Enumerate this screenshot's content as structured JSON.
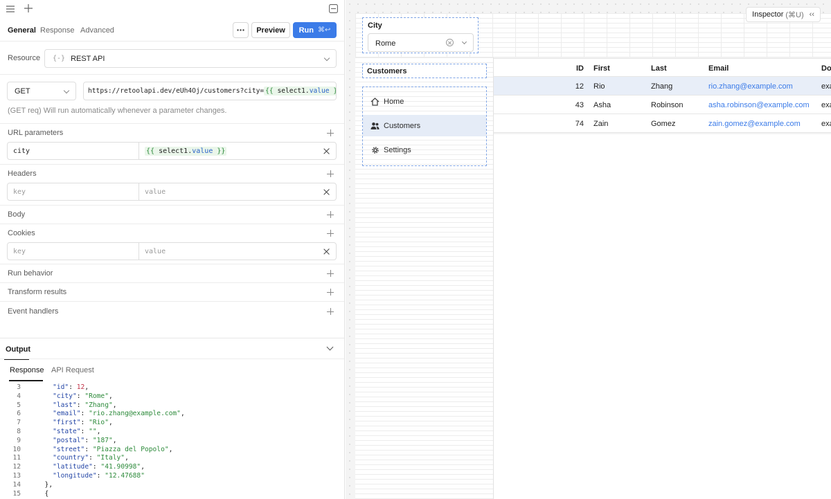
{
  "left": {
    "tabs": [
      "General",
      "Response",
      "Advanced"
    ],
    "buttons": {
      "preview": "Preview",
      "run": "Run",
      "run_shortcut": "⌘↩"
    },
    "resource_label": "Resource",
    "resource_value": "REST API",
    "method": "GET",
    "url_prefix": "https://retoolapi.dev/eUh4Oj/customers?city=",
    "url_template_open": "{{ ",
    "url_template_id": "select1",
    "url_template_dot": ".",
    "url_template_prop": "value",
    "url_template_close": " }}",
    "hint": "(GET req) Will run automatically whenever a parameter changes.",
    "sections": {
      "url_params": "URL parameters",
      "headers": "Headers",
      "body": "Body",
      "cookies": "Cookies",
      "run_behavior": "Run behavior",
      "transform": "Transform results",
      "event_handlers": "Event handlers"
    },
    "url_param": {
      "key": "city",
      "t_open": "{{ ",
      "t_id": "select1",
      "t_dot": ".",
      "t_prop": "value",
      "t_close": " }}"
    },
    "kv_placeholder": {
      "key": "key",
      "value": "value"
    }
  },
  "output": {
    "title": "Output",
    "tabs": [
      "Response",
      "API Request"
    ],
    "lines": [
      {
        "n": "3",
        "k": "id",
        "v": "12",
        "t": "num"
      },
      {
        "n": "4",
        "k": "city",
        "v": "Rome",
        "t": "str"
      },
      {
        "n": "5",
        "k": "last",
        "v": "Zhang",
        "t": "str"
      },
      {
        "n": "6",
        "k": "email",
        "v": "rio.zhang@example.com",
        "t": "str"
      },
      {
        "n": "7",
        "k": "first",
        "v": "Rio",
        "t": "str"
      },
      {
        "n": "8",
        "k": "state",
        "v": "",
        "t": "str"
      },
      {
        "n": "9",
        "k": "postal",
        "v": "187",
        "t": "str"
      },
      {
        "n": "10",
        "k": "street",
        "v": "Piazza del Popolo",
        "t": "str"
      },
      {
        "n": "11",
        "k": "country",
        "v": "Italy",
        "t": "str"
      },
      {
        "n": "12",
        "k": "latitude",
        "v": "41.90998",
        "t": "str"
      },
      {
        "n": "13",
        "k": "longitude",
        "v": "12.47688",
        "t": "str",
        "last": true
      },
      {
        "n": "14",
        "raw": "  },",
        "t": "raw"
      },
      {
        "n": "15",
        "raw": "  {",
        "t": "raw"
      }
    ]
  },
  "canvas": {
    "inspector": "Inspector",
    "inspector_shortcut": "(⌘U)",
    "city_label": "City",
    "city_value": "Rome",
    "customers_title": "Customers",
    "nav": [
      "Home",
      "Customers",
      "Settings"
    ],
    "table": {
      "headers": [
        "ID",
        "First",
        "Last",
        "Email",
        "Do"
      ],
      "rows": [
        [
          "12",
          "Rio",
          "Zhang",
          "rio.zhang@example.com",
          "exa"
        ],
        [
          "43",
          "Asha",
          "Robinson",
          "asha.robinson@example.com",
          "exa"
        ],
        [
          "74",
          "Zain",
          "Gomez",
          "zain.gomez@example.com",
          "exa"
        ]
      ]
    }
  }
}
